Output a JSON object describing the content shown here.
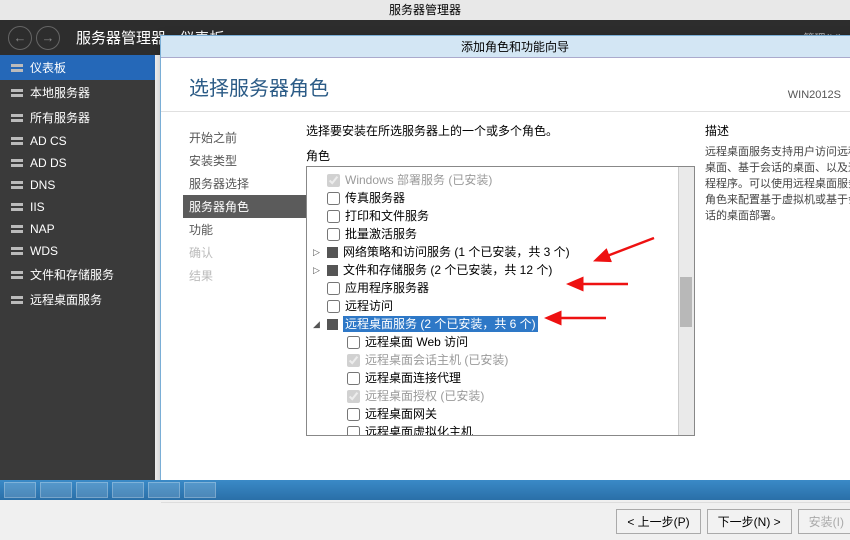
{
  "app_title": "服务器管理器",
  "titlebar": {
    "text": "服务器管理器 · 仪表板",
    "manage": "管理(M)"
  },
  "sidebar": {
    "items": [
      {
        "label": "仪表板",
        "active": true
      },
      {
        "label": "本地服务器"
      },
      {
        "label": "所有服务器"
      },
      {
        "label": "AD CS"
      },
      {
        "label": "AD DS"
      },
      {
        "label": "DNS"
      },
      {
        "label": "IIS"
      },
      {
        "label": "NAP"
      },
      {
        "label": "WDS"
      },
      {
        "label": "文件和存储服务"
      },
      {
        "label": "远程桌面服务"
      }
    ]
  },
  "dialog": {
    "title": "添加角色和功能向导",
    "heading": "选择服务器角色",
    "server": "WIN2012S",
    "nav": [
      {
        "label": "开始之前"
      },
      {
        "label": "安装类型"
      },
      {
        "label": "服务器选择"
      },
      {
        "label": "服务器角色",
        "current": true
      },
      {
        "label": "功能"
      },
      {
        "label": "确认",
        "disabled": true
      },
      {
        "label": "结果",
        "disabled": true
      }
    ],
    "intro": "选择要安装在所选服务器上的一个或多个角色。",
    "roles_label": "角色",
    "desc_label": "描述",
    "desc_text": "远程桌面服务支持用户访问远程桌面、基于会话的桌面、以及远程程序。可以使用远程桌面服务角色来配置基于虚拟机或基于会话的桌面部署。",
    "roles": [
      {
        "label": "Windows 部署服务 (已安装)",
        "checked": true,
        "disabled": true,
        "truncated": true
      },
      {
        "label": "传真服务器"
      },
      {
        "label": "打印和文件服务"
      },
      {
        "label": "批量激活服务"
      },
      {
        "label": "网络策略和访问服务 (1 个已安装，共 3 个)",
        "expand": "closed",
        "fill": true
      },
      {
        "label": "文件和存储服务 (2 个已安装，共 12 个)",
        "expand": "closed",
        "fill": true
      },
      {
        "label": "应用程序服务器"
      },
      {
        "label": "远程访问"
      },
      {
        "label": "远程桌面服务 (2 个已安装，共 6 个)",
        "expand": "open",
        "fill": true,
        "selected": true
      },
      {
        "label": "远程桌面 Web 访问",
        "child": true
      },
      {
        "label": "远程桌面会话主机 (已安装)",
        "child": true,
        "checked": true,
        "disabled": true
      },
      {
        "label": "远程桌面连接代理",
        "child": true
      },
      {
        "label": "远程桌面授权 (已安装)",
        "child": true,
        "checked": true,
        "disabled": true
      },
      {
        "label": "远程桌面网关",
        "child": true
      },
      {
        "label": "远程桌面虚拟化主机",
        "child": true
      }
    ],
    "buttons": {
      "prev": "< 上一步(P)",
      "next": "下一步(N) >",
      "install": "安装(I)"
    }
  }
}
